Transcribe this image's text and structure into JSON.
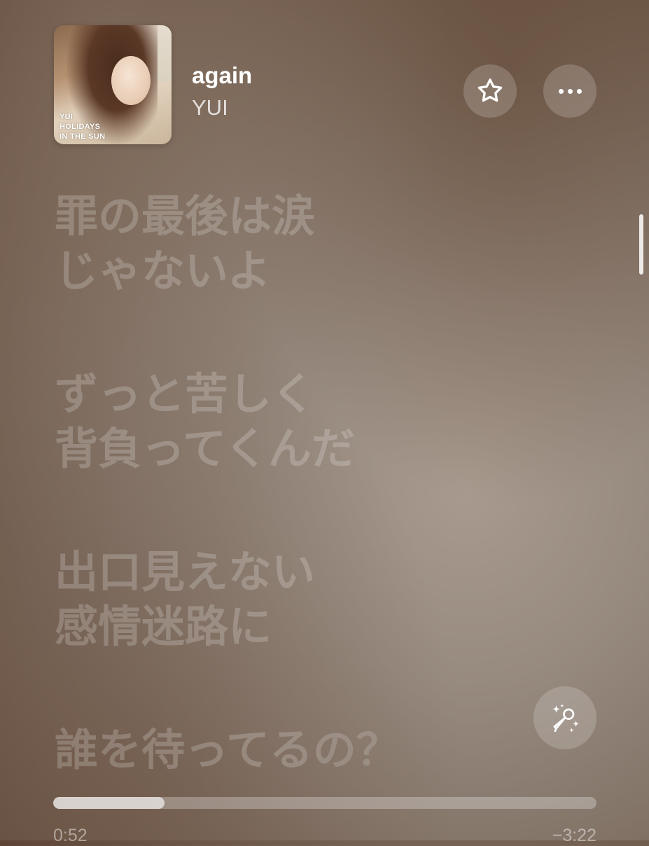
{
  "now_playing": {
    "album_art": {
      "cover_lines": [
        "YUI",
        "HOLIDAYS",
        "IN THE SUN"
      ]
    },
    "title": "again",
    "artist": "YUI",
    "favorite_icon": "star-icon",
    "more_icon": "ellipsis-icon"
  },
  "lyrics": {
    "stanzas": [
      [
        "罪の最後は涙",
        "じゃないよ"
      ],
      [
        "ずっと苦しく",
        "背負ってくんだ"
      ],
      [
        "出口見えない",
        "感情迷路に"
      ],
      [
        "誰を待ってるの？"
      ]
    ]
  },
  "karaoke": {
    "icon": "microphone-sparkles-icon"
  },
  "playback": {
    "progress_fraction": 0.205,
    "elapsed": "0:52",
    "remaining": "−3:22"
  },
  "colors": {
    "accent_text": "#ffffff",
    "dim_lyric": "rgba(255,255,255,0.20)"
  }
}
